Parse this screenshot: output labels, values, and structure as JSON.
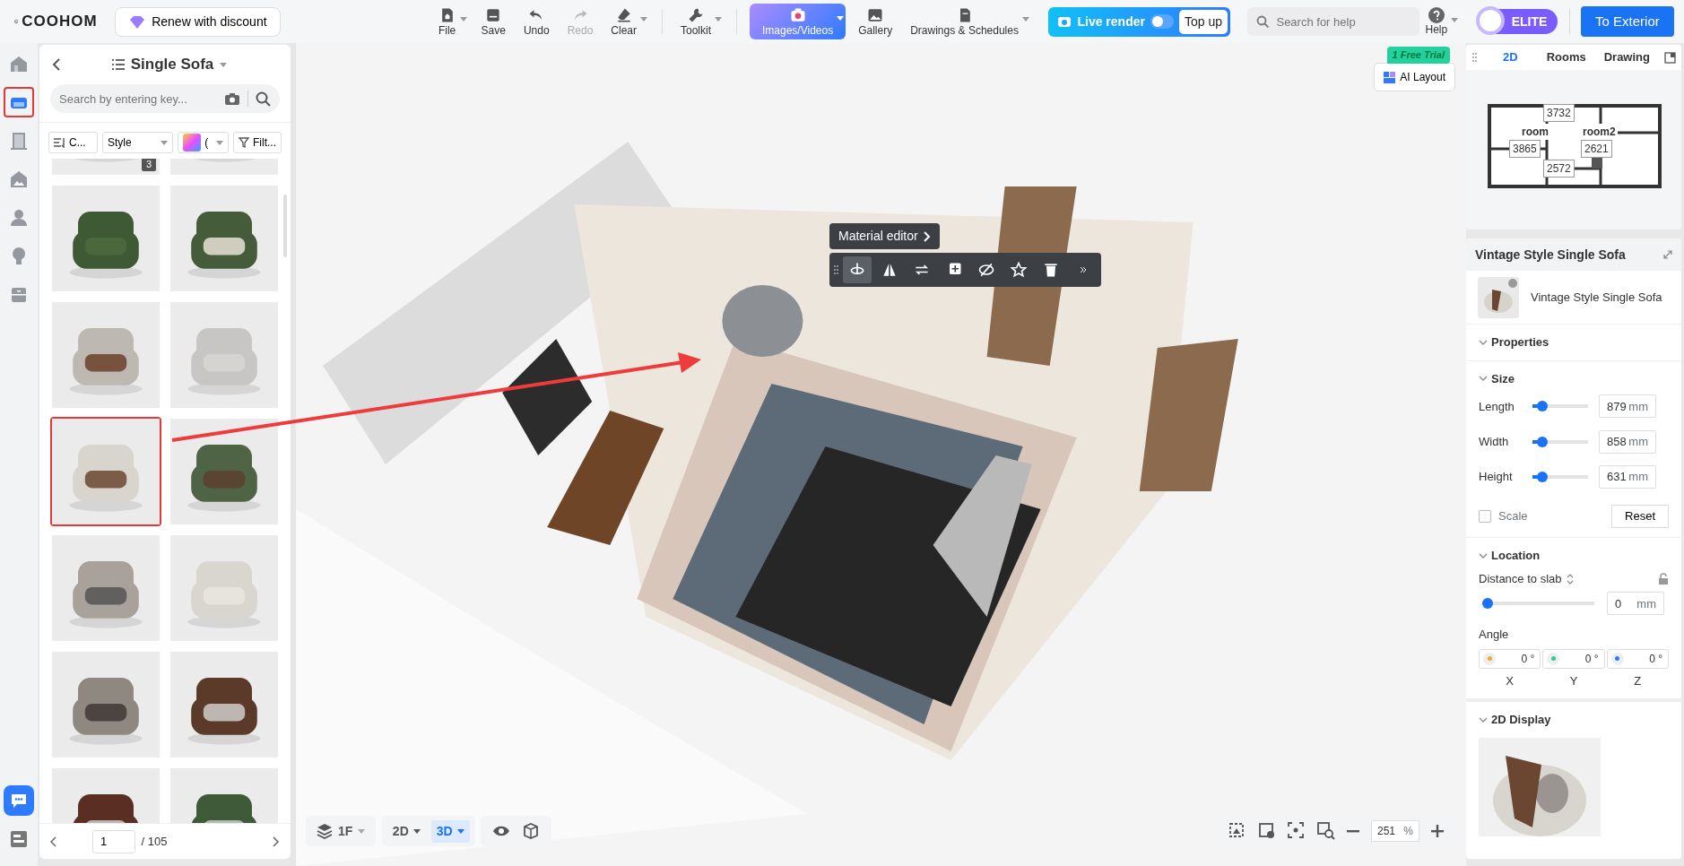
{
  "topbar": {
    "logo": "COOHOM",
    "renew": "Renew with discount",
    "tools": [
      {
        "kind": "file",
        "label": "File",
        "caret": true,
        "disabled": false,
        "selected": false
      },
      {
        "kind": "save",
        "label": "Save",
        "caret": false,
        "disabled": false,
        "selected": false
      },
      {
        "kind": "undo",
        "label": "Undo",
        "caret": false,
        "disabled": false,
        "selected": false
      },
      {
        "kind": "redo",
        "label": "Redo",
        "caret": false,
        "disabled": true,
        "selected": false
      },
      {
        "kind": "clear",
        "label": "Clear",
        "caret": true,
        "disabled": false,
        "selected": false
      },
      {
        "kind": "toolkit",
        "label": "Toolkit",
        "caret": true,
        "disabled": false,
        "selected": false
      },
      {
        "kind": "images",
        "label": "Images/Videos",
        "caret": true,
        "disabled": false,
        "selected": true
      },
      {
        "kind": "gallery",
        "label": "Gallery",
        "caret": false,
        "disabled": false,
        "selected": false
      },
      {
        "kind": "drawings",
        "label": "Drawings & Schedules",
        "caret": true,
        "disabled": false,
        "selected": false
      }
    ],
    "live_render": {
      "label": "Live render",
      "on": false,
      "top_up": "Top up"
    },
    "search": {
      "placeholder": "Search for help"
    },
    "help": "Help",
    "elite": "ELITE",
    "exterior": "To Exterior"
  },
  "rail": [
    {
      "kind": "house",
      "selected": false
    },
    {
      "kind": "sofa",
      "selected": true
    },
    {
      "kind": "door",
      "selected": false
    },
    {
      "kind": "wall",
      "selected": false
    },
    {
      "kind": "person",
      "selected": false
    },
    {
      "kind": "bulb",
      "selected": false
    },
    {
      "kind": "cabinet",
      "selected": false
    }
  ],
  "catalog": {
    "title": "Single Sofa",
    "search_placeholder": "Search by entering key...",
    "filters": [
      {
        "kind": "sort",
        "label": "C..."
      },
      {
        "kind": "select",
        "label": "Style"
      },
      {
        "kind": "color",
        "label": "("
      },
      {
        "kind": "filter",
        "label": "Filt..."
      }
    ],
    "items": [
      {
        "kind": "picture",
        "selected": false,
        "badge": "3"
      },
      {
        "kind": "picture",
        "selected": false
      },
      {
        "kind": "picture",
        "selected": false
      },
      {
        "kind": "picture",
        "selected": false
      },
      {
        "kind": "picture",
        "selected": false
      },
      {
        "kind": "picture",
        "selected": false
      },
      {
        "kind": "picture",
        "selected": true
      },
      {
        "kind": "picture",
        "selected": false
      },
      {
        "kind": "picture",
        "selected": false
      },
      {
        "kind": "picture",
        "selected": false
      },
      {
        "kind": "picture",
        "selected": false
      },
      {
        "kind": "picture",
        "selected": false
      },
      {
        "kind": "picture",
        "selected": false
      },
      {
        "kind": "picture",
        "selected": false
      }
    ],
    "page": "1",
    "pages": "/ 105"
  },
  "canvas": {
    "ai_layout": {
      "label": "AI Layout",
      "badge": "1 Free Trial"
    },
    "material_editor": "Material editor",
    "object_tools": [
      {
        "kind": "rotate",
        "selected": true
      },
      {
        "kind": "mirror",
        "selected": false
      },
      {
        "kind": "swap",
        "selected": false
      },
      {
        "kind": "add",
        "selected": false
      },
      {
        "kind": "hide",
        "selected": false
      },
      {
        "kind": "star",
        "selected": false
      },
      {
        "kind": "delete",
        "selected": false
      },
      {
        "kind": "more",
        "selected": false
      }
    ],
    "floor": "1F",
    "views": [
      {
        "label": "2D",
        "selected": false
      },
      {
        "label": "3D",
        "selected": true
      }
    ],
    "zoom": {
      "value": "251",
      "unit": "%"
    }
  },
  "minimap": {
    "tabs": [
      {
        "label": "2D",
        "selected": true
      },
      {
        "label": "Rooms",
        "selected": false
      },
      {
        "label": "Drawing",
        "selected": false
      }
    ],
    "labels": [
      {
        "kind": "room",
        "text": "room"
      },
      {
        "kind": "room",
        "text": "room2"
      },
      {
        "kind": "dim",
        "text": "3732"
      },
      {
        "kind": "dim",
        "text": "3865"
      },
      {
        "kind": "dim",
        "text": "2621"
      },
      {
        "kind": "dim",
        "text": "2572"
      }
    ]
  },
  "properties": {
    "title": "Vintage Style Single Sofa",
    "name": "Vintage Style Single Sofa",
    "section": "Properties",
    "size_heading": "Size",
    "size": [
      {
        "label": "Length",
        "level": 0.1,
        "value": "879",
        "unit": "mm"
      },
      {
        "label": "Width",
        "level": 0.1,
        "value": "858",
        "unit": "mm"
      },
      {
        "label": "Height",
        "level": 0.1,
        "value": "631",
        "unit": "mm"
      }
    ],
    "scale": {
      "label": "Scale",
      "checked": false
    },
    "reset": "Reset",
    "location_heading": "Location",
    "distance": {
      "label": "Distance to slab",
      "level": 0,
      "value": "0",
      "unit": "mm"
    },
    "angle_label": "Angle",
    "angles": [
      {
        "axis": "X",
        "value": "0 °",
        "color": "#f5a623"
      },
      {
        "axis": "Y",
        "value": "0 °",
        "color": "#2ecc9a"
      },
      {
        "axis": "Z",
        "value": "0 °",
        "color": "#2f7bff"
      }
    ],
    "display_heading": "2D Display"
  }
}
